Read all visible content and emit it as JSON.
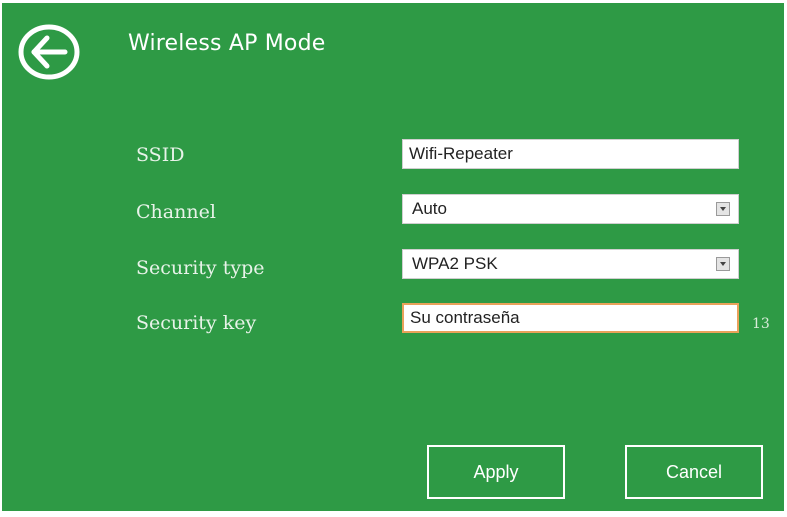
{
  "header": {
    "title": "Wireless AP Mode",
    "back_icon": "arrow-left-circle-icon"
  },
  "form": {
    "ssid": {
      "label": "SSID",
      "value": "Wifi-Repeater"
    },
    "channel": {
      "label": "Channel",
      "value": "Auto"
    },
    "security_type": {
      "label": "Security type",
      "value": "WPA2 PSK"
    },
    "security_key": {
      "label": "Security key",
      "value": "Su contraseña",
      "char_count": "13"
    }
  },
  "actions": {
    "apply_label": "Apply",
    "cancel_label": "Cancel"
  },
  "colors": {
    "background": "#2e9a45",
    "text": "#ffffff",
    "key_field_border": "#e9a25a"
  }
}
